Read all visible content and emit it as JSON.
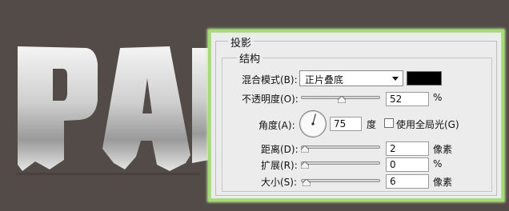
{
  "canvas": {
    "artwork_letters": "PA",
    "background_color": "#524b48"
  },
  "panel": {
    "title": "投影",
    "section": "结构",
    "accent_color": "#9ee06a",
    "blend_mode": {
      "label": "混合模式(B):",
      "value": "正片叠底",
      "color": "#000000"
    },
    "opacity": {
      "label": "不透明度(O):",
      "value": "52",
      "unit": "%",
      "level_percent": 52
    },
    "angle": {
      "label": "角度(A):",
      "value": "75",
      "unit": "度",
      "global_light_label": "使用全局光(G)",
      "global_light_checked": false,
      "dial_degrees": 75
    },
    "distance": {
      "label": "距离(D):",
      "value": "2",
      "unit": "像素",
      "level_percent": 0
    },
    "spread": {
      "label": "扩展(R):",
      "value": "0",
      "unit": "%",
      "level_percent": 0
    },
    "size": {
      "label": "大小(S):",
      "value": "6",
      "unit": "像素",
      "level_percent": 2
    }
  }
}
